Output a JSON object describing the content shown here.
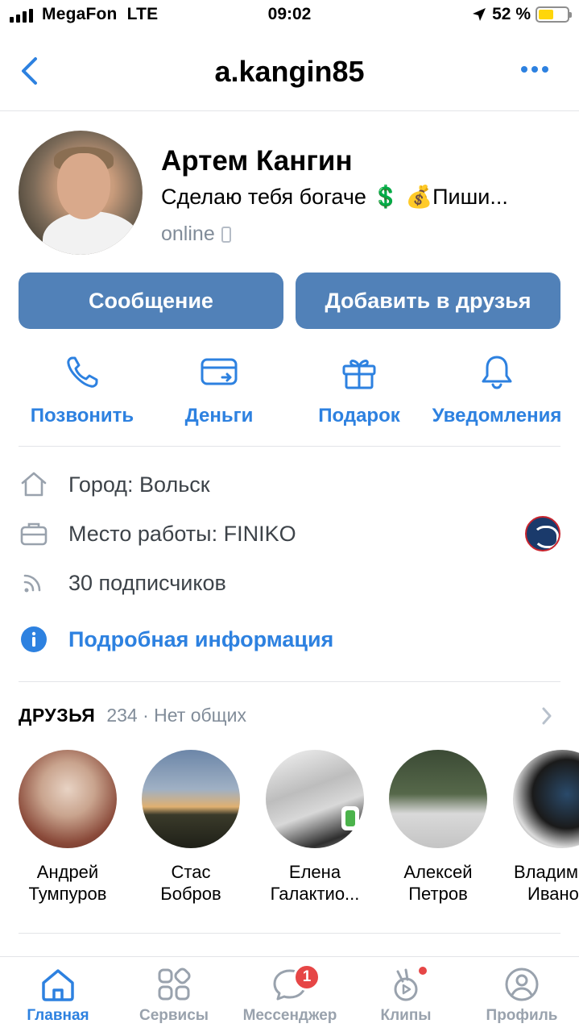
{
  "status_bar": {
    "carrier": "MegaFon",
    "network": "LTE",
    "time": "09:02",
    "battery_percent": "52 %",
    "battery_level": 0.52
  },
  "nav": {
    "title": "a.kangin85",
    "back_icon": "chevron-left-icon",
    "more_icon": "more-horizontal-icon"
  },
  "profile": {
    "name": "Артем Кангин",
    "status": "Сделаю тебя богаче 💲 💰Пиши...",
    "online": "online"
  },
  "buttons": {
    "message": "Сообщение",
    "add_friend": "Добавить в друзья"
  },
  "quick_actions": [
    {
      "label": "Позвонить",
      "icon": "phone-icon"
    },
    {
      "label": "Деньги",
      "icon": "money-transfer-icon"
    },
    {
      "label": "Подарок",
      "icon": "gift-icon"
    },
    {
      "label": "Уведомления",
      "icon": "bell-icon"
    }
  ],
  "info": {
    "city": "Город: Вольск",
    "work": "Место работы: FINIKO",
    "followers": "30 подписчиков",
    "details": "Подробная информация"
  },
  "friends": {
    "title": "ДРУЗЬЯ",
    "count": "234 · Нет общих",
    "items": [
      {
        "first": "Андрей",
        "last": "Тумпуров"
      },
      {
        "first": "Стас",
        "last": "Бобров"
      },
      {
        "first": "Елена",
        "last": "Галактио..."
      },
      {
        "first": "Алексей",
        "last": "Петров"
      },
      {
        "first": "Владим",
        "last": "Ивано"
      }
    ]
  },
  "tabs": [
    {
      "label": "Главная",
      "icon": "home-icon",
      "active": true
    },
    {
      "label": "Сервисы",
      "icon": "services-icon"
    },
    {
      "label": "Мессенджер",
      "icon": "messenger-icon",
      "badge": "1"
    },
    {
      "label": "Клипы",
      "icon": "clips-icon"
    },
    {
      "label": "Профиль",
      "icon": "profile-icon"
    }
  ],
  "colors": {
    "accent": "#2d81e0",
    "button": "#5181b8",
    "secondary_text": "#818c99",
    "badge": "#e64646",
    "online": "#4bb34b"
  }
}
